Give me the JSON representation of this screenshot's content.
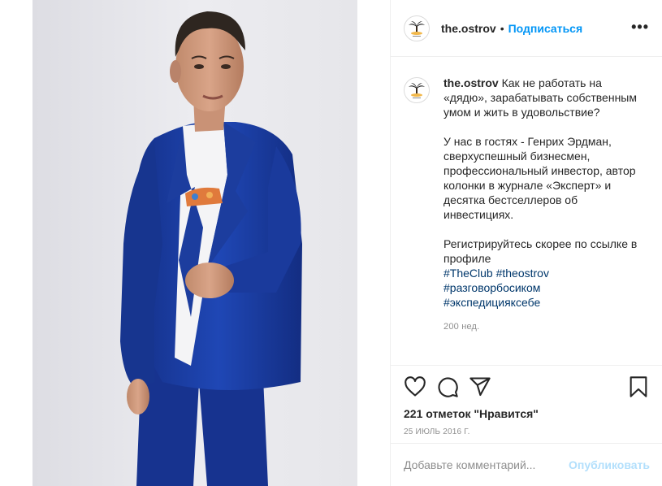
{
  "post": {
    "author": "the.ostrov",
    "dot": "•",
    "follow_label": "Подписаться",
    "more_label": "•••",
    "caption": {
      "author": "the.ostrov",
      "intro": "Как не работать на «дядю», зарабатывать собственным умом и жить в удовольствие?",
      "guest": "У нас в гостях - Генрих Эрдман, сверхуспешный бизнесмен, профессиональный инвестор, автор колонки в журнале «Эксперт» и десятка бестселлеров об инвестициях.",
      "cta": "Регистрируйтесь скорее по ссылке в профиле",
      "tags": [
        "#TheClub #theostrov",
        "#разговорбосиком",
        "#экспедицияксебе"
      ],
      "time": "200 нед."
    },
    "likes": "221 отметок \"Нравится\"",
    "date": "25 ИЮЛЬ 2016 Г.",
    "comment_placeholder": "Добавьте комментарий...",
    "publish_label": "Опубликовать"
  },
  "icons": {
    "like": "heart-icon",
    "comment": "comment-icon",
    "share": "share-icon",
    "save": "bookmark-icon",
    "avatar": "palm-logo-icon"
  },
  "colors": {
    "link_blue": "#0095f6",
    "publish_disabled": "#b2dffc",
    "hashtag": "#00376b",
    "secondary_text": "#8e8e8e",
    "suit_blue": "#1a3fa3"
  }
}
